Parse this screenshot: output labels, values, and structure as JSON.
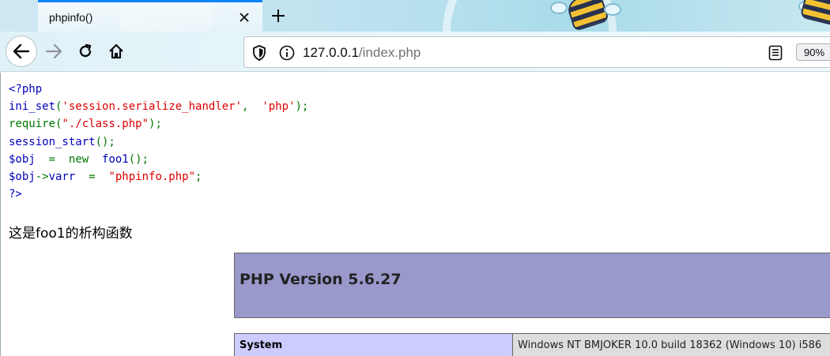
{
  "tab": {
    "title": "phpinfo()"
  },
  "toolbar": {
    "url_host": "127.0.0.1",
    "url_path": "/index.php",
    "zoom": "90%"
  },
  "code_lines": [
    {
      "parts": [
        {
          "t": "<?php",
          "c": "c-blue"
        }
      ]
    },
    {
      "parts": [
        {
          "t": "ini_set",
          "c": "c-blue"
        },
        {
          "t": "(",
          "c": "c-green"
        },
        {
          "t": "'session.serialize_handler'",
          "c": "c-red"
        },
        {
          "t": ",  ",
          "c": "c-green"
        },
        {
          "t": "'php'",
          "c": "c-red"
        },
        {
          "t": ");",
          "c": "c-green"
        }
      ]
    },
    {
      "parts": [
        {
          "t": "require(",
          "c": "c-green"
        },
        {
          "t": "\"./class.php\"",
          "c": "c-red"
        },
        {
          "t": ");",
          "c": "c-green"
        }
      ]
    },
    {
      "parts": [
        {
          "t": "session_start",
          "c": "c-blue"
        },
        {
          "t": "();",
          "c": "c-green"
        }
      ]
    },
    {
      "parts": [
        {
          "t": "$obj  ",
          "c": "c-blue"
        },
        {
          "t": "=  new  ",
          "c": "c-green"
        },
        {
          "t": "foo1",
          "c": "c-blue"
        },
        {
          "t": "();",
          "c": "c-green"
        }
      ]
    },
    {
      "parts": [
        {
          "t": "$obj",
          "c": "c-blue"
        },
        {
          "t": "->",
          "c": "c-green"
        },
        {
          "t": "varr  ",
          "c": "c-blue"
        },
        {
          "t": "=  ",
          "c": "c-green"
        },
        {
          "t": "\"phpinfo.php\"",
          "c": "c-red"
        },
        {
          "t": ";",
          "c": "c-green"
        }
      ]
    },
    {
      "parts": [
        {
          "t": "?>",
          "c": "c-blue"
        }
      ]
    }
  ],
  "output_text": "这是foo1的析构函数",
  "phpinfo": {
    "title": "PHP Version 5.6.27",
    "rows": [
      {
        "key": "System",
        "value": "Windows NT BMJOKER 10.0 build 18362 (Windows 10) i586"
      }
    ]
  }
}
